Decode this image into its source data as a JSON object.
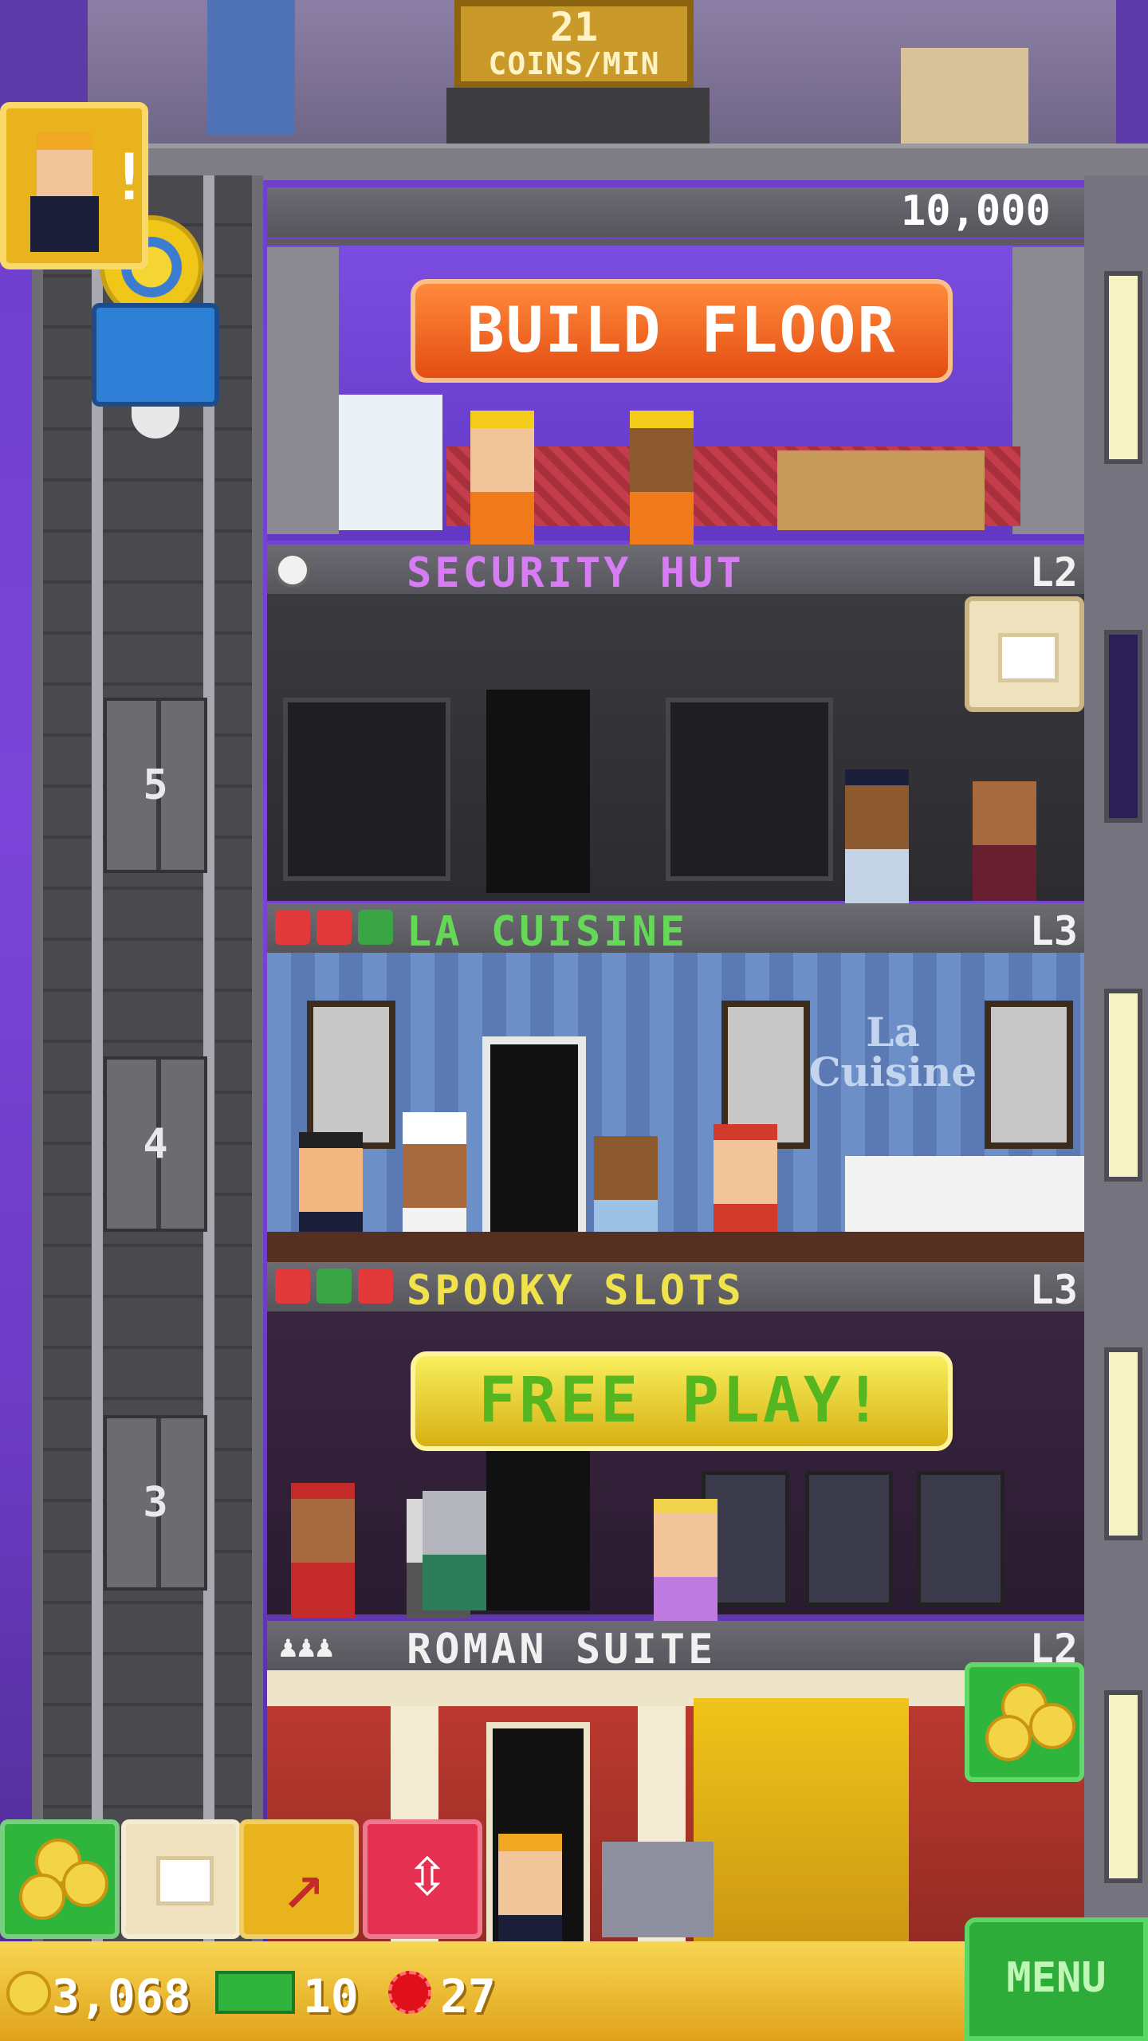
{
  "header": {
    "rate_value": "21",
    "rate_unit": "COINS/MIN"
  },
  "build_floor": {
    "price": "10,000",
    "button_label": "BUILD FLOOR"
  },
  "floors": [
    {
      "name": "SECURITY HUT",
      "level": "L2",
      "title_color": "#d77cf4",
      "floor_number": "5"
    },
    {
      "name": "LA CUISINE",
      "level": "L3",
      "title_color": "#65d857",
      "floor_number": "4",
      "sign": "La Cuisine"
    },
    {
      "name": "SPOOKY SLOTS",
      "level": "L3",
      "title_color": "#f0e24a",
      "floor_number": "3",
      "action_label": "FREE PLAY!"
    },
    {
      "name": "ROMAN SUITE",
      "level": "L2",
      "title_color": "#f1f1f1"
    }
  ],
  "status": {
    "coins": "3,068",
    "bux": "10",
    "tickets": "27",
    "menu_label": "MENU"
  },
  "colors": {
    "accent_orange": "#f07a2a",
    "accent_green": "#2fb53b",
    "gold": "#e8b31d",
    "pink": "#e53052"
  }
}
